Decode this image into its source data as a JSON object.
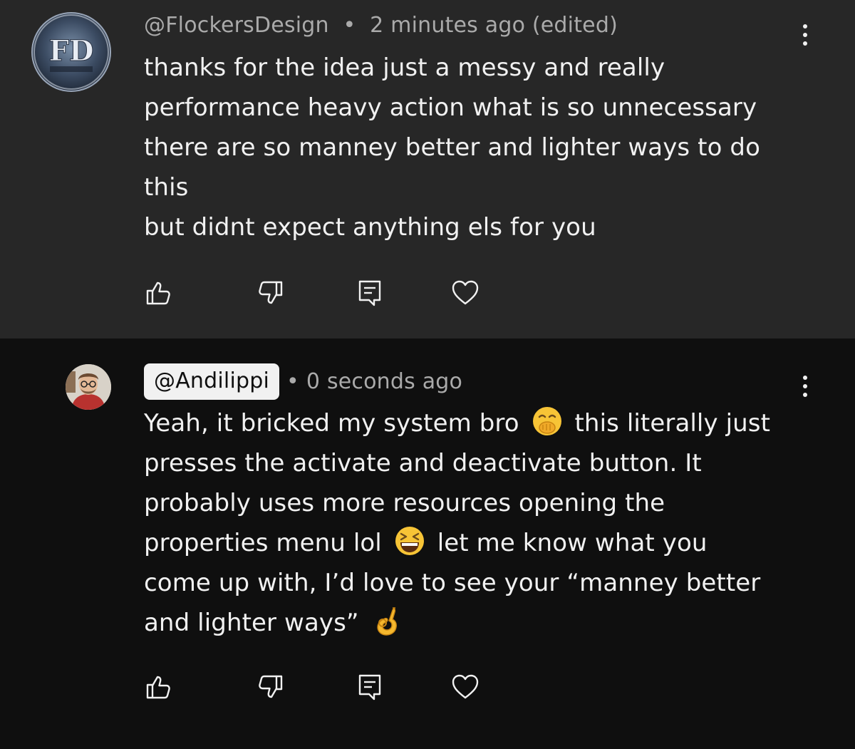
{
  "comments": [
    {
      "author": "@FlockersDesign",
      "separator": "•",
      "time": "2 minutes ago (edited)",
      "avatar_initials": "FD",
      "lines": [
        "thanks for the idea just a messy and really",
        "performance heavy action what is so unnecessary",
        "there are so manney better and lighter ways to do",
        "this",
        "but didnt expect anything els for you"
      ]
    },
    {
      "author": "@Andilippi",
      "separator": "•",
      "time": "0 seconds ago",
      "lines": [
        {
          "a": "Yeah, it bricked my system bro",
          "emoji": "face-with-hand-over-mouth",
          "b": "this literally just"
        },
        {
          "a": "presses the activate and deactivate button. It"
        },
        {
          "a": "probably uses more resources opening the"
        },
        {
          "a": "properties menu lol",
          "emoji": "grinning-squinting-face",
          "b": "let me know what you"
        },
        {
          "a": "come up with, I’d love to see your “manney better"
        },
        {
          "a": "and lighter ways”",
          "emoji": "ok-hand"
        }
      ]
    }
  ],
  "actions": [
    "like-icon",
    "dislike-icon",
    "reply-icon",
    "heart-icon"
  ],
  "colors": {
    "highlighted_bg": "#272727",
    "page_bg": "#0f0f0f",
    "text": "#f1f1f1",
    "meta_text": "#aaaaaa"
  }
}
